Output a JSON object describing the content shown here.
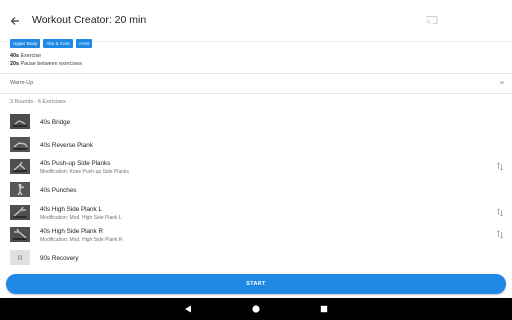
{
  "header": {
    "title": "Workout Creator: 20 min"
  },
  "tags": [
    "Upper Body",
    "Abs & Core",
    "Arms"
  ],
  "stats": {
    "exercise_value": "40s",
    "exercise_label": " Exercise",
    "pause_value": "20s",
    "pause_label": " Pause between exercises"
  },
  "warmup": {
    "label": "Warm-Up"
  },
  "rounds_summary": "3 Rounds - 6 Exercises",
  "exercises": [
    {
      "name": "40s Bridge",
      "modification": ""
    },
    {
      "name": "40s Reverse Plank",
      "modification": ""
    },
    {
      "name": "40s Push-up Side Planks",
      "modification": "Modification: Knee Push-up Side Planks"
    },
    {
      "name": "40s Punches",
      "modification": ""
    },
    {
      "name": "40s High Side Plank L",
      "modification": "Modification: Mod. High Side Plank L"
    },
    {
      "name": "40s High Side Plank R",
      "modification": "Modification: Mod. High Side Plank R"
    },
    {
      "name": "90s Recovery",
      "modification": ""
    }
  ],
  "start_button": {
    "label": "START"
  },
  "icons": {
    "back": "arrow-left-icon",
    "cast": "cast-icon",
    "expand": "chevron-down-icon",
    "swap": "swap-icon",
    "pause": "pause-icon",
    "nav_back": "triangle-back-icon",
    "nav_home": "circle-home-icon",
    "nav_recents": "square-recents-icon"
  },
  "colors": {
    "accent": "#1e88e5",
    "navbar": "#000000"
  }
}
